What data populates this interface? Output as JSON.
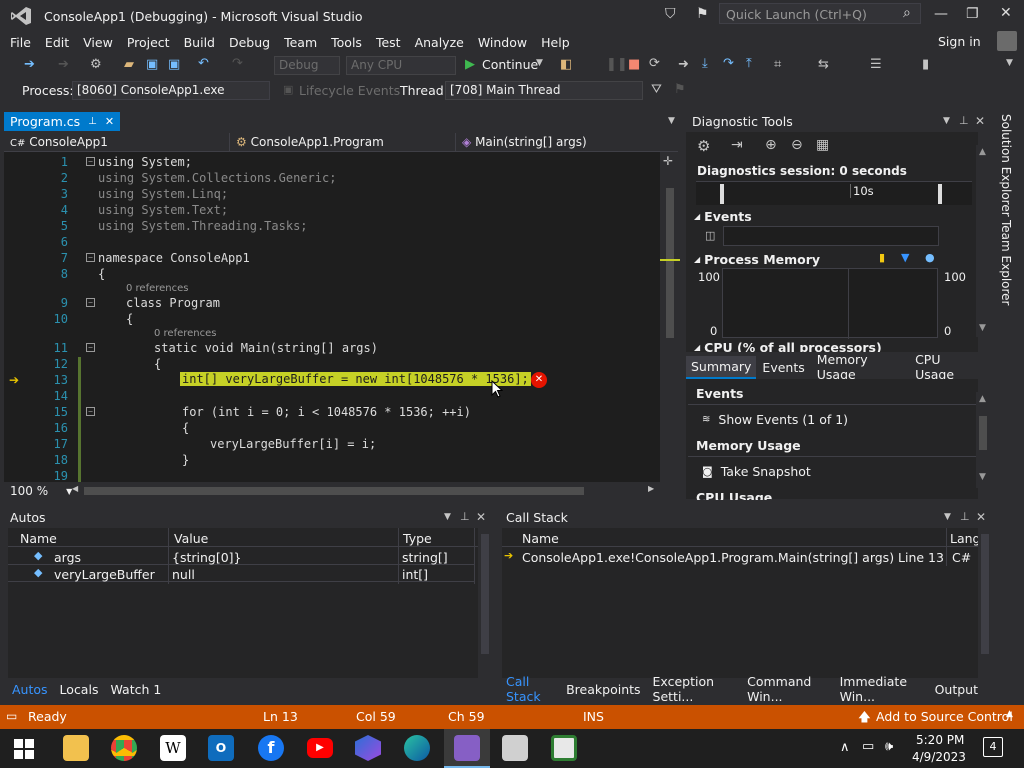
{
  "window": {
    "title": "ConsoleApp1 (Debugging) - Microsoft Visual Studio",
    "quick_launch_placeholder": "Quick Launch (Ctrl+Q)",
    "signin": "Sign in"
  },
  "menu": [
    "File",
    "Edit",
    "View",
    "Project",
    "Build",
    "Debug",
    "Team",
    "Tools",
    "Test",
    "Analyze",
    "Window",
    "Help"
  ],
  "toolbar": {
    "config": "Debug",
    "platform": "Any CPU",
    "continue": "Continue",
    "process_label": "Process:",
    "process_value": "[8060] ConsoleApp1.exe",
    "lifecycle": "Lifecycle Events",
    "thread_label": "Thread:",
    "thread_value": "[708] Main Thread"
  },
  "editor": {
    "tab": "Program.cs",
    "nav_project": "ConsoleApp1",
    "nav_class": "ConsoleApp1.Program",
    "nav_member": "Main(string[] args)",
    "zoom": "100 %",
    "lines": [
      "1",
      "2",
      "3",
      "4",
      "5",
      "6",
      "7",
      "8",
      "9",
      "10",
      "11",
      "12",
      "13",
      "14",
      "15",
      "16",
      "17",
      "18",
      "19"
    ],
    "lens_refs": "0 references",
    "code": {
      "l1": "using System;",
      "l2": "using System.Collections.Generic;",
      "l3": "using System.Linq;",
      "l4": "using System.Text;",
      "l5": "using System.Threading.Tasks;",
      "l7": "namespace ConsoleApp1",
      "l8": "{",
      "l9": "class Program",
      "l10": "{",
      "l11": "static void Main(string[] args)",
      "l12": "{",
      "l13": "int[] veryLargeBuffer = new int[1048576 * 1536];",
      "l15": "for (int i = 0; i < 1048576 * 1536; ++i)",
      "l16": "{",
      "l17": "veryLargeBuffer[i] = i;",
      "l18": "}"
    }
  },
  "diagnostics": {
    "title": "Diagnostic Tools",
    "session": "Diagnostics session: 0 seconds",
    "tick": "10s",
    "events": "Events",
    "process_memory": "Process Memory",
    "mem_max_left": "100",
    "mem_min_left": "0",
    "mem_max_right": "100",
    "mem_min_right": "0",
    "cpu": "CPU (% of all processors)",
    "tabs": [
      "Summary",
      "Events",
      "Memory Usage",
      "CPU Usage"
    ],
    "sec_events": "Events",
    "show_events": "Show Events (1 of 1)",
    "sec_memory": "Memory Usage",
    "take_snapshot": "Take Snapshot",
    "sec_cpu": "CPU Usage"
  },
  "side_tabs": [
    "Solution Explorer",
    "Team Explorer"
  ],
  "autos": {
    "title": "Autos",
    "columns": [
      "Name",
      "Value",
      "Type"
    ],
    "rows": [
      {
        "name": "args",
        "value": "{string[0]}",
        "type": "string[]"
      },
      {
        "name": "veryLargeBuffer",
        "value": "null",
        "type": "int[]"
      }
    ],
    "tabs": [
      "Autos",
      "Locals",
      "Watch 1"
    ]
  },
  "callstack": {
    "title": "Call Stack",
    "columns": [
      "Name",
      "Lang"
    ],
    "rows": [
      {
        "name": "ConsoleApp1.exe!ConsoleApp1.Program.Main(string[] args) Line 13",
        "lang": "C#"
      }
    ],
    "tabs": [
      "Call Stack",
      "Breakpoints",
      "Exception Setti...",
      "Command Win...",
      "Immediate Win...",
      "Output"
    ]
  },
  "status": {
    "ready": "Ready",
    "ln": "Ln 13",
    "col": "Col 59",
    "ch": "Ch 59",
    "ins": "INS",
    "source_control": "Add to Source Control"
  },
  "taskbar": {
    "time": "5:20 PM",
    "date": "4/9/2023",
    "notifications": "4"
  },
  "colors": {
    "accent": "#007acc",
    "status": "#ca5100",
    "highlight": "#c6d126"
  }
}
